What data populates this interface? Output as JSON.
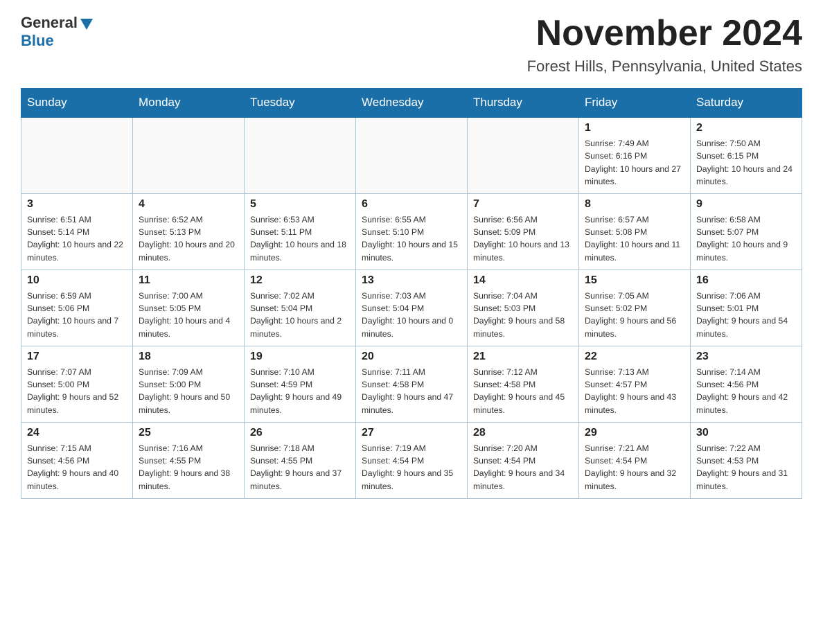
{
  "logo": {
    "general_text": "General",
    "blue_text": "Blue"
  },
  "header": {
    "month_year": "November 2024",
    "location": "Forest Hills, Pennsylvania, United States"
  },
  "weekdays": [
    "Sunday",
    "Monday",
    "Tuesday",
    "Wednesday",
    "Thursday",
    "Friday",
    "Saturday"
  ],
  "weeks": [
    [
      {
        "day": "",
        "sunrise": "",
        "sunset": "",
        "daylight": ""
      },
      {
        "day": "",
        "sunrise": "",
        "sunset": "",
        "daylight": ""
      },
      {
        "day": "",
        "sunrise": "",
        "sunset": "",
        "daylight": ""
      },
      {
        "day": "",
        "sunrise": "",
        "sunset": "",
        "daylight": ""
      },
      {
        "day": "",
        "sunrise": "",
        "sunset": "",
        "daylight": ""
      },
      {
        "day": "1",
        "sunrise": "Sunrise: 7:49 AM",
        "sunset": "Sunset: 6:16 PM",
        "daylight": "Daylight: 10 hours and 27 minutes."
      },
      {
        "day": "2",
        "sunrise": "Sunrise: 7:50 AM",
        "sunset": "Sunset: 6:15 PM",
        "daylight": "Daylight: 10 hours and 24 minutes."
      }
    ],
    [
      {
        "day": "3",
        "sunrise": "Sunrise: 6:51 AM",
        "sunset": "Sunset: 5:14 PM",
        "daylight": "Daylight: 10 hours and 22 minutes."
      },
      {
        "day": "4",
        "sunrise": "Sunrise: 6:52 AM",
        "sunset": "Sunset: 5:13 PM",
        "daylight": "Daylight: 10 hours and 20 minutes."
      },
      {
        "day": "5",
        "sunrise": "Sunrise: 6:53 AM",
        "sunset": "Sunset: 5:11 PM",
        "daylight": "Daylight: 10 hours and 18 minutes."
      },
      {
        "day": "6",
        "sunrise": "Sunrise: 6:55 AM",
        "sunset": "Sunset: 5:10 PM",
        "daylight": "Daylight: 10 hours and 15 minutes."
      },
      {
        "day": "7",
        "sunrise": "Sunrise: 6:56 AM",
        "sunset": "Sunset: 5:09 PM",
        "daylight": "Daylight: 10 hours and 13 minutes."
      },
      {
        "day": "8",
        "sunrise": "Sunrise: 6:57 AM",
        "sunset": "Sunset: 5:08 PM",
        "daylight": "Daylight: 10 hours and 11 minutes."
      },
      {
        "day": "9",
        "sunrise": "Sunrise: 6:58 AM",
        "sunset": "Sunset: 5:07 PM",
        "daylight": "Daylight: 10 hours and 9 minutes."
      }
    ],
    [
      {
        "day": "10",
        "sunrise": "Sunrise: 6:59 AM",
        "sunset": "Sunset: 5:06 PM",
        "daylight": "Daylight: 10 hours and 7 minutes."
      },
      {
        "day": "11",
        "sunrise": "Sunrise: 7:00 AM",
        "sunset": "Sunset: 5:05 PM",
        "daylight": "Daylight: 10 hours and 4 minutes."
      },
      {
        "day": "12",
        "sunrise": "Sunrise: 7:02 AM",
        "sunset": "Sunset: 5:04 PM",
        "daylight": "Daylight: 10 hours and 2 minutes."
      },
      {
        "day": "13",
        "sunrise": "Sunrise: 7:03 AM",
        "sunset": "Sunset: 5:04 PM",
        "daylight": "Daylight: 10 hours and 0 minutes."
      },
      {
        "day": "14",
        "sunrise": "Sunrise: 7:04 AM",
        "sunset": "Sunset: 5:03 PM",
        "daylight": "Daylight: 9 hours and 58 minutes."
      },
      {
        "day": "15",
        "sunrise": "Sunrise: 7:05 AM",
        "sunset": "Sunset: 5:02 PM",
        "daylight": "Daylight: 9 hours and 56 minutes."
      },
      {
        "day": "16",
        "sunrise": "Sunrise: 7:06 AM",
        "sunset": "Sunset: 5:01 PM",
        "daylight": "Daylight: 9 hours and 54 minutes."
      }
    ],
    [
      {
        "day": "17",
        "sunrise": "Sunrise: 7:07 AM",
        "sunset": "Sunset: 5:00 PM",
        "daylight": "Daylight: 9 hours and 52 minutes."
      },
      {
        "day": "18",
        "sunrise": "Sunrise: 7:09 AM",
        "sunset": "Sunset: 5:00 PM",
        "daylight": "Daylight: 9 hours and 50 minutes."
      },
      {
        "day": "19",
        "sunrise": "Sunrise: 7:10 AM",
        "sunset": "Sunset: 4:59 PM",
        "daylight": "Daylight: 9 hours and 49 minutes."
      },
      {
        "day": "20",
        "sunrise": "Sunrise: 7:11 AM",
        "sunset": "Sunset: 4:58 PM",
        "daylight": "Daylight: 9 hours and 47 minutes."
      },
      {
        "day": "21",
        "sunrise": "Sunrise: 7:12 AM",
        "sunset": "Sunset: 4:58 PM",
        "daylight": "Daylight: 9 hours and 45 minutes."
      },
      {
        "day": "22",
        "sunrise": "Sunrise: 7:13 AM",
        "sunset": "Sunset: 4:57 PM",
        "daylight": "Daylight: 9 hours and 43 minutes."
      },
      {
        "day": "23",
        "sunrise": "Sunrise: 7:14 AM",
        "sunset": "Sunset: 4:56 PM",
        "daylight": "Daylight: 9 hours and 42 minutes."
      }
    ],
    [
      {
        "day": "24",
        "sunrise": "Sunrise: 7:15 AM",
        "sunset": "Sunset: 4:56 PM",
        "daylight": "Daylight: 9 hours and 40 minutes."
      },
      {
        "day": "25",
        "sunrise": "Sunrise: 7:16 AM",
        "sunset": "Sunset: 4:55 PM",
        "daylight": "Daylight: 9 hours and 38 minutes."
      },
      {
        "day": "26",
        "sunrise": "Sunrise: 7:18 AM",
        "sunset": "Sunset: 4:55 PM",
        "daylight": "Daylight: 9 hours and 37 minutes."
      },
      {
        "day": "27",
        "sunrise": "Sunrise: 7:19 AM",
        "sunset": "Sunset: 4:54 PM",
        "daylight": "Daylight: 9 hours and 35 minutes."
      },
      {
        "day": "28",
        "sunrise": "Sunrise: 7:20 AM",
        "sunset": "Sunset: 4:54 PM",
        "daylight": "Daylight: 9 hours and 34 minutes."
      },
      {
        "day": "29",
        "sunrise": "Sunrise: 7:21 AM",
        "sunset": "Sunset: 4:54 PM",
        "daylight": "Daylight: 9 hours and 32 minutes."
      },
      {
        "day": "30",
        "sunrise": "Sunrise: 7:22 AM",
        "sunset": "Sunset: 4:53 PM",
        "daylight": "Daylight: 9 hours and 31 minutes."
      }
    ]
  ]
}
